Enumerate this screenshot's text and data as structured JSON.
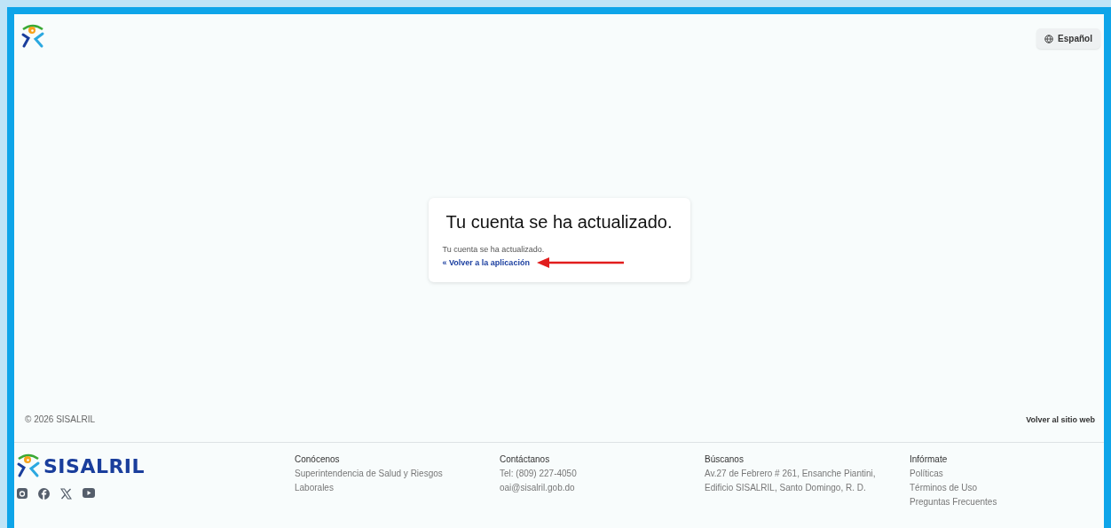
{
  "header": {
    "language_button": "Español"
  },
  "card": {
    "title": "Tu cuenta se ha actualizado.",
    "message": "Tu cuenta se ha actualizado.",
    "link": "« Volver a la aplicación"
  },
  "bottom_bar": {
    "copyright": "© 2026 SISALRIL",
    "back_link": "Volver al sitio web"
  },
  "footer": {
    "brand": "SISALRIL",
    "columns": [
      {
        "heading": "Conócenos",
        "lines": [
          "Superintendencia de Salud y Riesgos Laborales"
        ]
      },
      {
        "heading": "Contáctanos",
        "lines": [
          "Tel: (809) 227-4050",
          "oai@sisalril.gob.do"
        ]
      },
      {
        "heading": "Búscanos",
        "lines": [
          "Av.27 de Febrero # 261, Ensanche Piantini, Edificio SISALRIL, Santo Domingo, R. D."
        ]
      },
      {
        "heading": "Infórmate",
        "lines": [
          "Políticas",
          "Términos de Uso",
          "Preguntas Frecuentes"
        ]
      }
    ]
  }
}
